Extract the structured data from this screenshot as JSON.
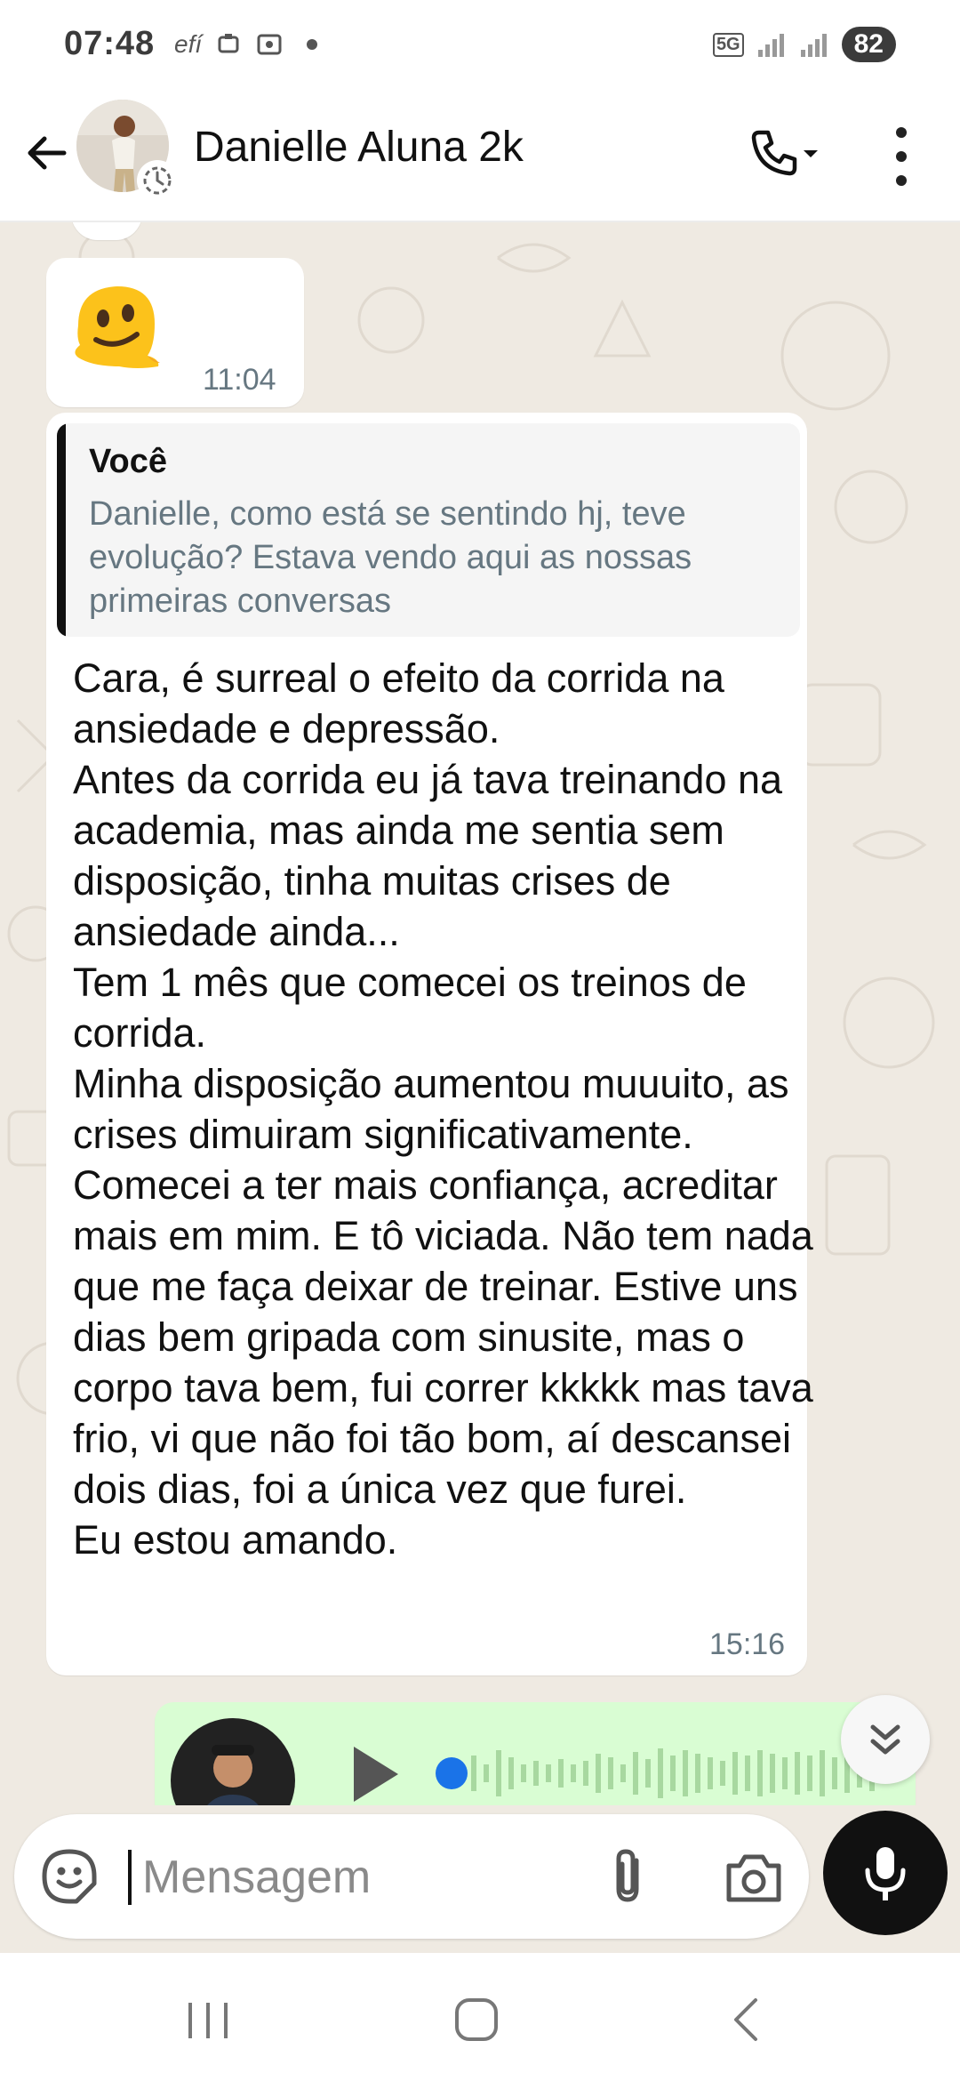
{
  "status_bar": {
    "time": "07:48",
    "carrier_text": "efí",
    "network": "5G",
    "battery": "82"
  },
  "header": {
    "contact_name": "Danielle Aluna 2k",
    "icons": [
      "back-arrow-icon",
      "status-icon",
      "phone-icon",
      "more-vert-icon"
    ]
  },
  "messages": [
    {
      "direction": "incoming",
      "type": "emoji",
      "content_icon": "melting-face-emoji",
      "time": "11:04"
    },
    {
      "direction": "incoming",
      "type": "text",
      "quote": {
        "author": "Você",
        "text": "Danielle, como está se sentindo hj, teve evolução? Estava vendo aqui as nossas primeiras conversas"
      },
      "text": "Cara, é surreal o efeito da corrida na ansiedade e depressão.\nAntes da corrida eu já tava treinando na academia, mas ainda me sentia sem disposição, tinha muitas crises de ansiedade ainda...\nTem 1 mês que comecei os treinos de corrida.\nMinha disposição aumentou muuuito, as crises dimuiram significativamente. Comecei a ter mais confiança, acreditar mais em mim. E tô viciada. Não tem nada que me faça deixar de treinar. Estive uns dias bem gripada com sinusite, mas o corpo tava bem, fui correr kkkkk mas tava frio, vi que não foi tão bom, aí descansei dois dias, foi a única vez que furei.\nEu estou amando.",
      "time": "15:16"
    },
    {
      "direction": "outgoing",
      "type": "voice",
      "progress": 0,
      "icons": [
        "play-icon",
        "waveform"
      ]
    }
  ],
  "composer": {
    "placeholder": "Mensagem",
    "icons": [
      "emoji-sticker-icon",
      "attach-icon",
      "camera-icon",
      "mic-icon"
    ]
  },
  "colors": {
    "incoming_bubble": "#ffffff",
    "outgoing_bubble": "#d9fdd3",
    "chat_background": "#efeae2",
    "voice_accent": "#1a73e8",
    "mic_button": "#111111"
  }
}
